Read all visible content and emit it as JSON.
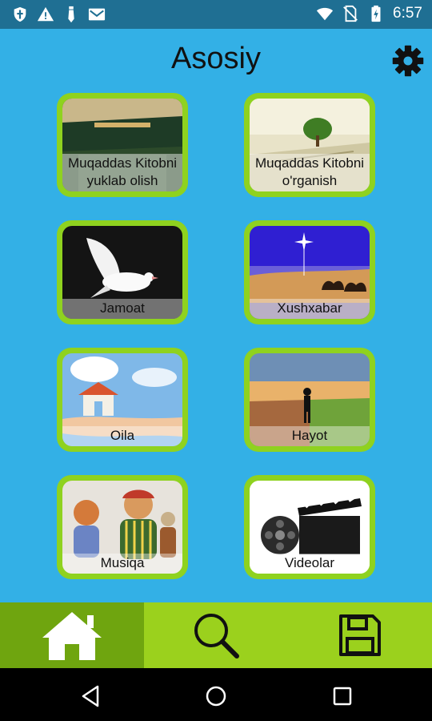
{
  "status_bar": {
    "time": "6:57",
    "left_icons": [
      "shield-icon",
      "warning-icon",
      "tie-icon",
      "mail-icon"
    ],
    "right_icons": [
      "wifi-icon",
      "no-sim-icon",
      "battery-icon"
    ]
  },
  "header": {
    "title": "Asosiy",
    "settings_icon": "gear-icon"
  },
  "tiles": [
    {
      "label": "Muqaddas Kitobni yuklab olish"
    },
    {
      "label": "Muqaddas Kitobni o'rganish"
    },
    {
      "label": "Jamoat"
    },
    {
      "label": "Xushxabar"
    },
    {
      "label": "Oila"
    },
    {
      "label": "Hayot"
    },
    {
      "label": "Musiqa"
    },
    {
      "label": "Videolar"
    }
  ],
  "bottom_nav": {
    "items": [
      {
        "icon": "home-icon",
        "active": true
      },
      {
        "icon": "search-icon",
        "active": false
      },
      {
        "icon": "save-icon",
        "active": false
      }
    ]
  },
  "colors": {
    "background": "#33b0e6",
    "tile_border": "#8fd21f",
    "nav_bar": "#9bd11d",
    "nav_active": "#6fa50f",
    "status_bar": "#1f6f93"
  }
}
